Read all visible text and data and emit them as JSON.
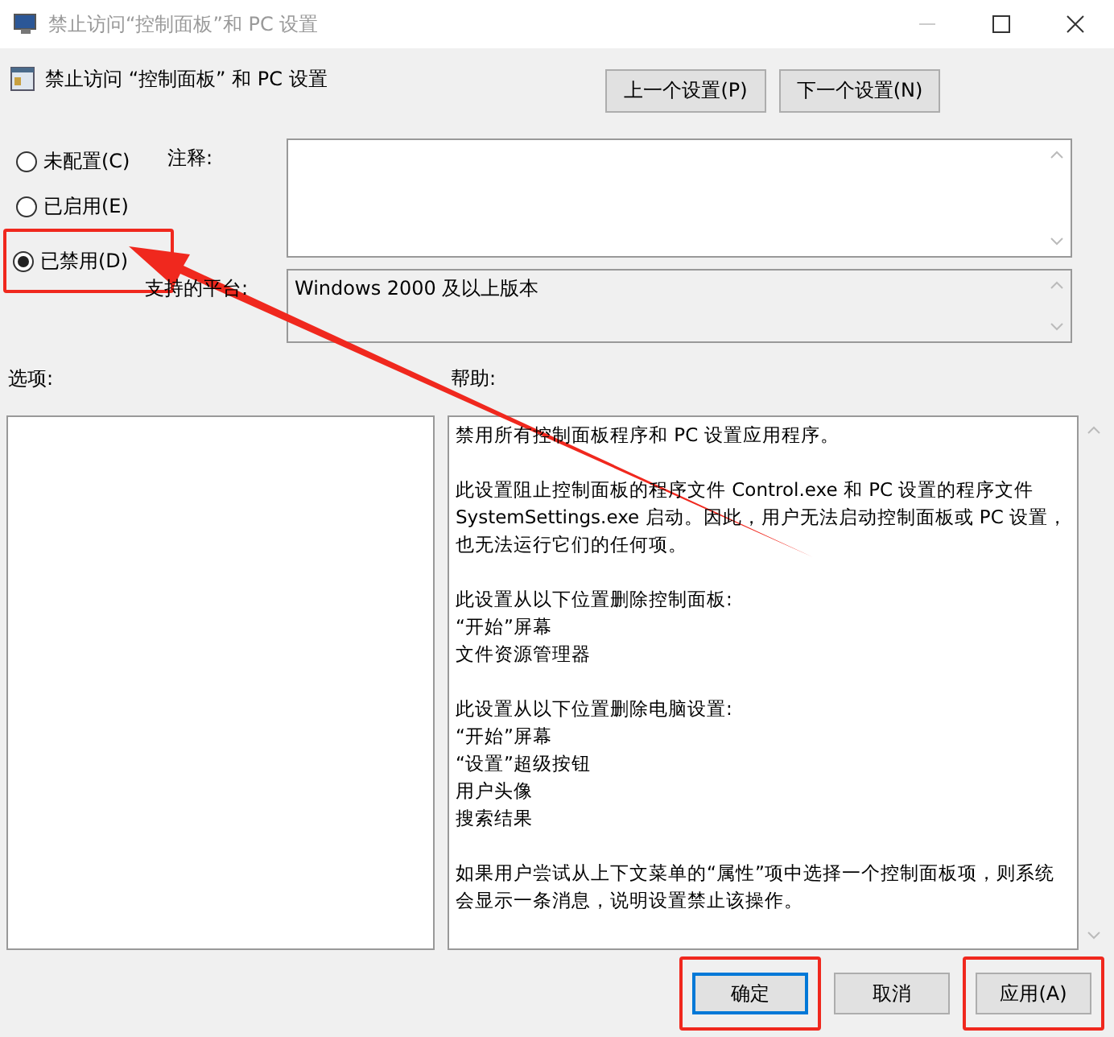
{
  "window": {
    "title": "禁止访问“控制面板”和 PC 设置"
  },
  "policy_title": "禁止访问 “控制面板” 和 PC 设置",
  "nav_buttons": [
    "上一个设置(P)",
    "下一个设置(N)"
  ],
  "radios": [
    {
      "label": "未配置(C)",
      "selected": false,
      "highlighted": false
    },
    {
      "label": "已启用(E)",
      "selected": false,
      "highlighted": false
    },
    {
      "label": "已禁用(D)",
      "selected": true,
      "highlighted": true
    }
  ],
  "comment": {
    "label": "注释:"
  },
  "platform": {
    "label": "支持的平台:",
    "value": "Windows 2000 及以上版本"
  },
  "options": {
    "label": "选项:"
  },
  "help": {
    "label": "帮助:",
    "paragraphs": [
      [
        "禁用所有控制面板程序和 PC 设置应用程序。"
      ],
      [
        "此设置阻止控制面板的程序文件 Control.exe 和 PC 设置的程序文件 SystemSettings.exe 启动。因此，用户无法启动控制面板或 PC 设置，也无法运行它们的任何项。"
      ],
      [
        "此设置从以下位置删除控制面板:",
        "“开始”屏幕",
        "文件资源管理器"
      ],
      [
        "此设置从以下位置删除电脑设置:",
        "“开始”屏幕",
        "“设置”超级按钮",
        "用户头像",
        "搜索结果"
      ],
      [
        "如果用户尝试从上下文菜单的“属性”项中选择一个控制面板项，则系统会显示一条消息，说明设置禁止该操作。"
      ]
    ]
  },
  "buttons": [
    {
      "label": "确定",
      "default": true,
      "highlighted": true
    },
    {
      "label": "取消",
      "default": false,
      "highlighted": false
    },
    {
      "label": "应用(A)",
      "default": false,
      "highlighted": true
    }
  ],
  "annotation_arrow": true
}
